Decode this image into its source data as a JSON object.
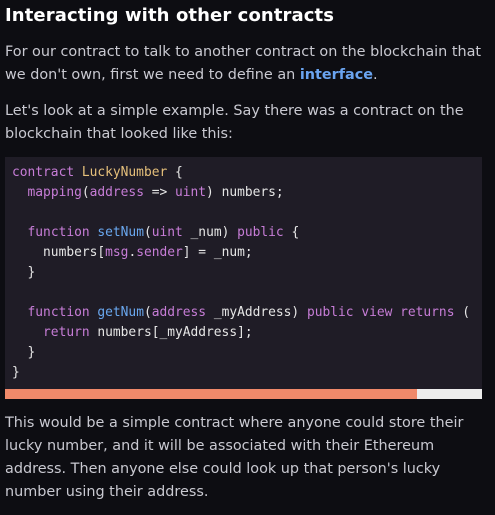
{
  "heading": "Interacting with other contracts",
  "para1": {
    "before": "For our contract to talk to another contract on the blockchain that we don't own, first we need to define an ",
    "link": "interface",
    "after": "."
  },
  "para2": "Let's look at a simple example. Say there was a contract on the blockchain that looked like this:",
  "code": {
    "kw_contract": "contract",
    "name": "LuckyNumber",
    "mapping_line": {
      "kw": "mapping",
      "k": "address",
      "arrow": " => ",
      "v": "uint",
      "rest": ") numbers;"
    },
    "set_fn": {
      "kw": "function",
      "name": "setNum",
      "param_type": "uint",
      "param": " _num) ",
      "vis": "public",
      "tail": " {"
    },
    "set_body": {
      "pre": "numbers[",
      "m1": "msg",
      "dot": ".",
      "m2": "sender",
      "post": "] = _num;"
    },
    "get_fn": {
      "kw": "function",
      "name": "getNum",
      "param_type": "address",
      "param": " _myAddress) ",
      "vis": "public",
      "view": "view",
      "returns": "returns",
      "tail": " ("
    },
    "get_body": {
      "kw": "return",
      "rest": " numbers[_myAddress];"
    }
  },
  "para3": "This would be a simple contract where anyone could store their lucky number, and it will be associated with their Ethereum address. Then anyone else could look up that person's lucky number using their address.",
  "colors": {
    "keyword": "#c77dd7",
    "function": "#6aa8f0",
    "class": "#e6c07b",
    "link": "#6aa4f0",
    "scroll_thumb": "#f0896a"
  },
  "scrollbar": {
    "position": 0.86
  }
}
